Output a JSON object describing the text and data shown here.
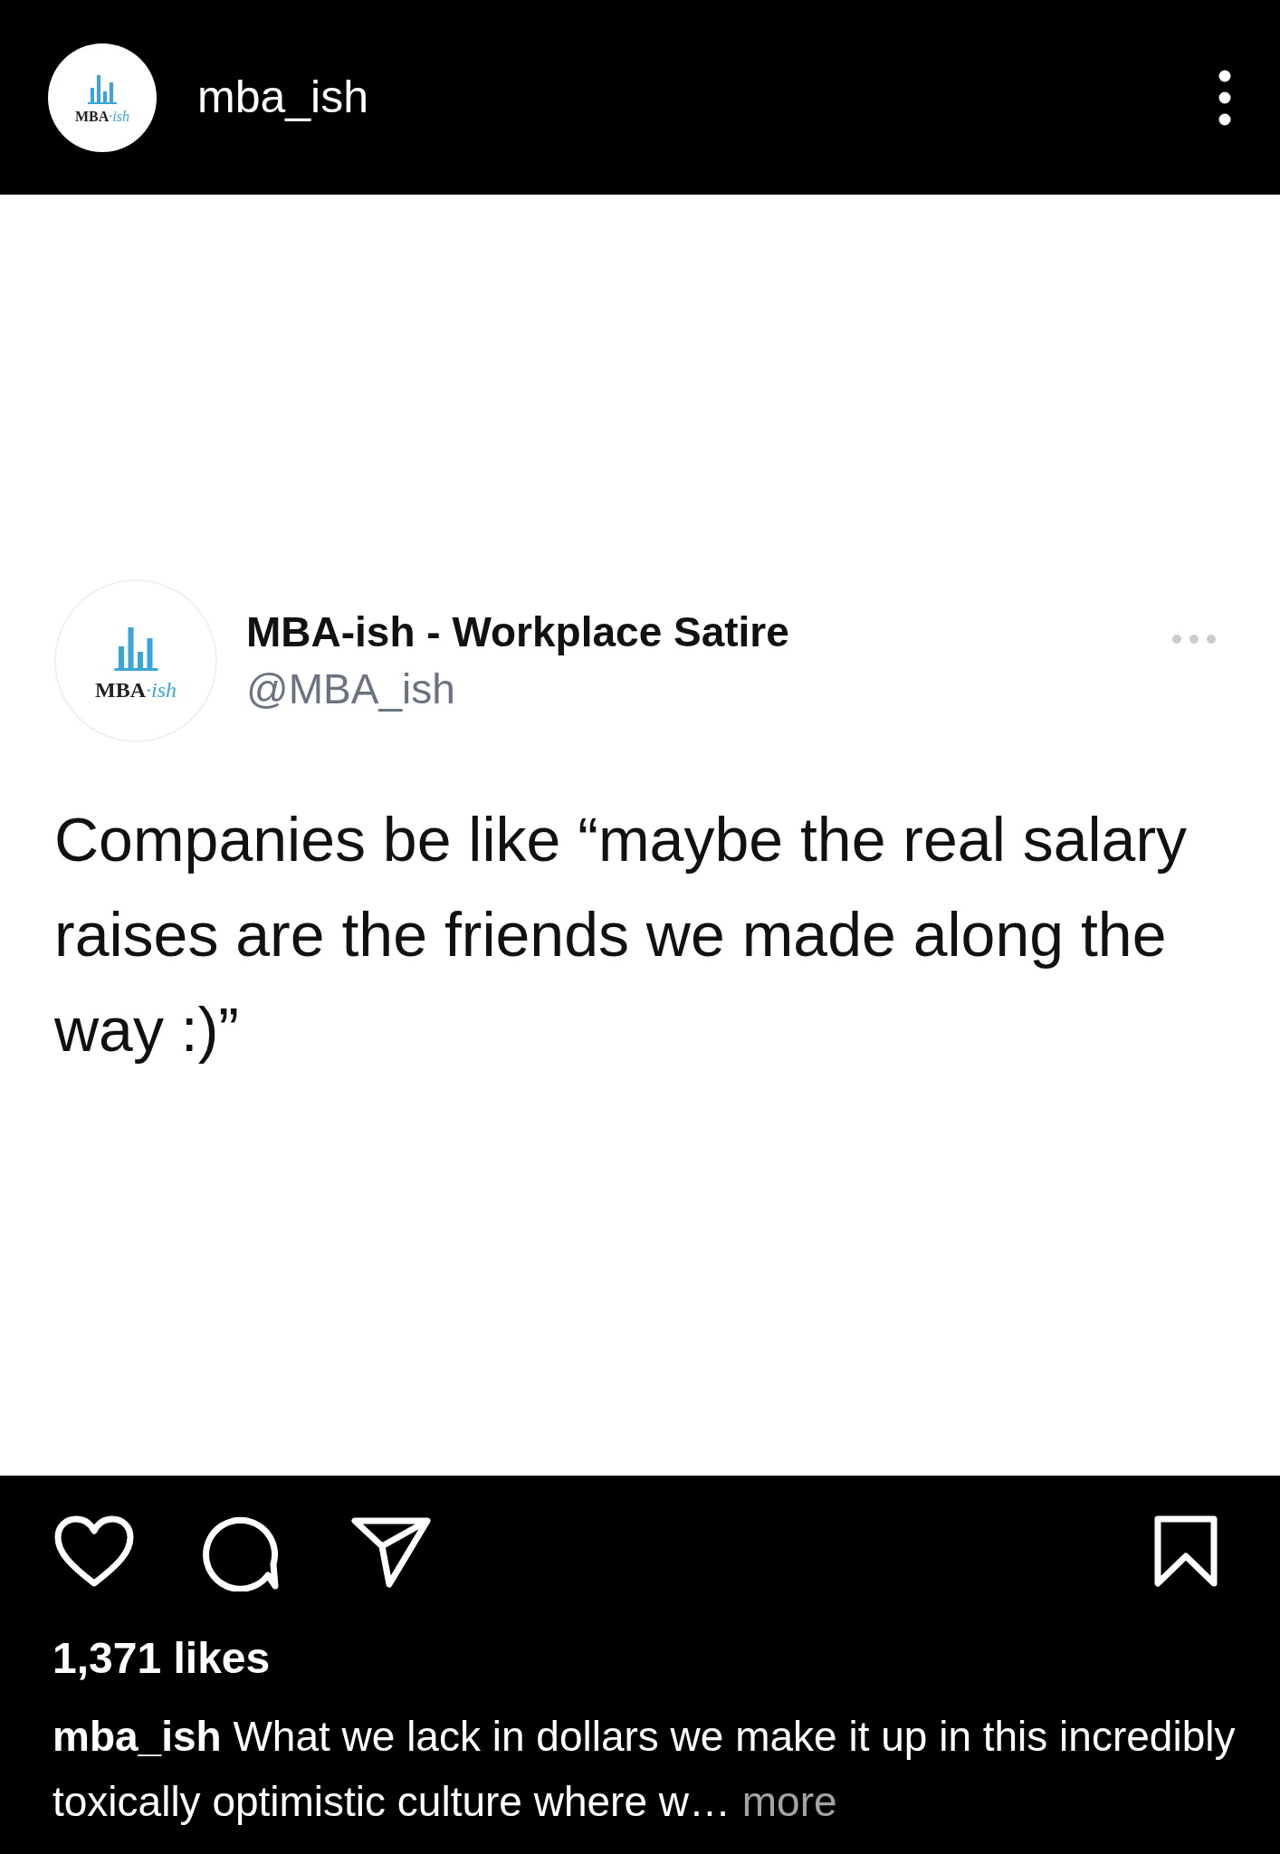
{
  "header": {
    "avatar_logo": {
      "brand": "MBA",
      "suffix": "·ish"
    },
    "username": "mba_ish"
  },
  "tweet": {
    "avatar_logo": {
      "brand": "MBA",
      "suffix": "·ish"
    },
    "name": "MBA-ish - Workplace Satire",
    "handle": "@MBA_ish",
    "text": "Companies be like “maybe the real salary raises are the friends we made along the way :)”"
  },
  "likes": "1,371 likes",
  "caption": {
    "username": "mba_ish",
    "text": "What we lack in dollars we make it up in this incredibly toxically optimistic culture where w…",
    "more": "more"
  }
}
